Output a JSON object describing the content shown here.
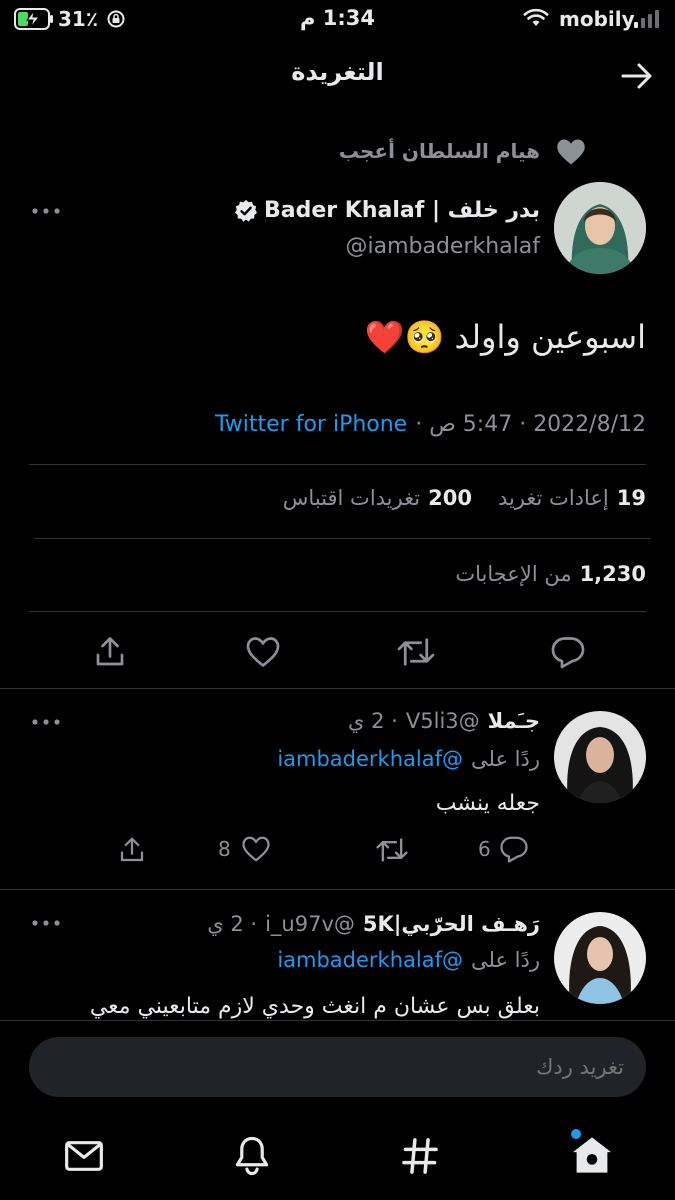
{
  "status_bar": {
    "battery_percent": "31٪",
    "time": "1:34 م",
    "carrier": "mobily"
  },
  "header": {
    "title": "التغريدة"
  },
  "tweet": {
    "social_context": "هيام السلطان أعجب",
    "author_name": "بدر خلف | Bader Khalaf",
    "author_handle": "@iambaderkhalaf",
    "text": "اسبوعين واولد 🥺❤️",
    "meta": "2022/8/12 · 5:47 ص ·",
    "source": "Twitter for iPhone",
    "stats": {
      "retweets_count": "19",
      "retweets_label": "إعادات تغريد",
      "quotes_count": "200",
      "quotes_label": "تغريدات اقتباس",
      "likes_count": "1,230",
      "likes_label": "من الإعجابات"
    }
  },
  "replies": [
    {
      "name": "جـَملا",
      "handle": "@V5li3",
      "time": "· 2 ي",
      "replying_to_label": "ردًا على",
      "replying_to_handle": "@iambaderkhalaf",
      "text": "جعله ينشب",
      "reply_count": "6",
      "like_count": "8"
    },
    {
      "name": "رَهـف الحرّبي|5K",
      "handle": "@i_u97v",
      "time": "· 2 ي",
      "replying_to_label": "ردًا على",
      "replying_to_handle": "@iambaderkhalaf",
      "text": "بعلق بس عشان م انغث وحدي لازم متابعيني معي"
    }
  ],
  "composer": {
    "placeholder": "تغريد ردك"
  },
  "colors": {
    "accent": "#1d9bf0",
    "battery": "#4cd964",
    "background": "#000000"
  }
}
